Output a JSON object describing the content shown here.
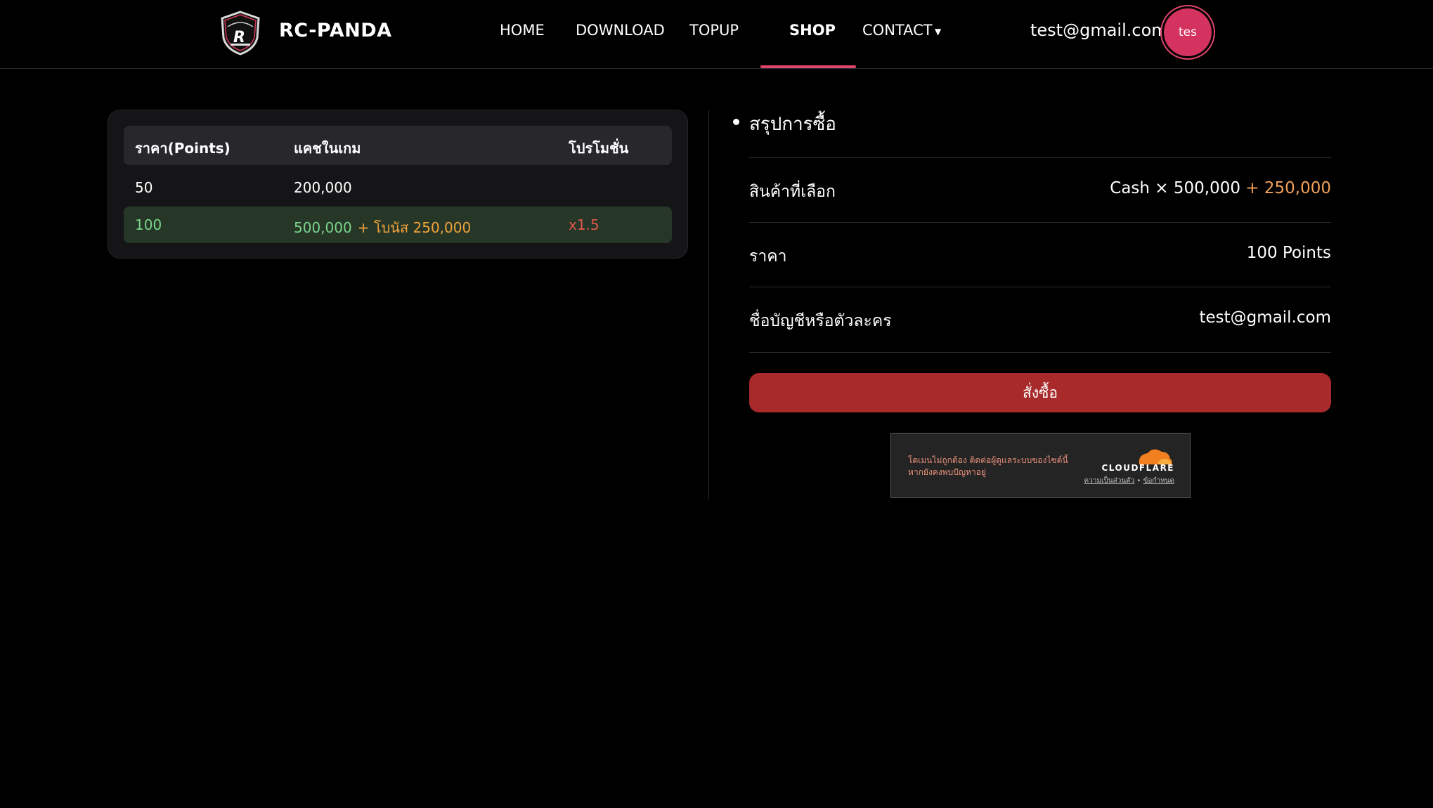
{
  "header": {
    "brand": "RC-PANDA",
    "nav": [
      {
        "label": "HOME"
      },
      {
        "label": "DOWNLOAD"
      },
      {
        "label": "TOPUP"
      },
      {
        "label": "SHOP",
        "active": true
      },
      {
        "label": "CONTACT"
      }
    ],
    "user_email": "test@gmail.com",
    "avatar_text": "tes"
  },
  "table": {
    "headers": [
      "ราคา(Points)",
      "แคชในเกม",
      "โปรโมชั่น"
    ],
    "rows": [
      {
        "points": "50",
        "cash": "200,000",
        "bonus": "",
        "promo": ""
      },
      {
        "points": "100",
        "cash": "500,000",
        "bonus": "+ โบนัส 250,000",
        "promo": "x1.5",
        "selected": true
      }
    ]
  },
  "summary": {
    "title": "สรุปการซื้อ",
    "rows": [
      {
        "label": "สินค้าที่เลือก",
        "value": "Cash × 500,000",
        "value_bonus": "+ 250,000"
      },
      {
        "label": "ราคา",
        "value": "100 Points"
      },
      {
        "label": "ชื่อบัญชีหรือตัวละคร",
        "value": "test@gmail.com"
      }
    ],
    "order_button": "สั่งซื้อ"
  },
  "cloudflare": {
    "message": "โดเมนไม่ถูกต้อง ติดต่อผู้ดูแลระบบของไซต์นี้ หากยังคงพบปัญหาอยู่",
    "brand": "CLOUDFLARE",
    "privacy": "ความเป็นส่วนตัว",
    "separator": "•",
    "terms": "ข้อกำหนด"
  },
  "colors": {
    "accent": "#e0456c",
    "selected_row": "#263728",
    "order_button": "#a92a2a",
    "bonus": "#f0a33a"
  }
}
